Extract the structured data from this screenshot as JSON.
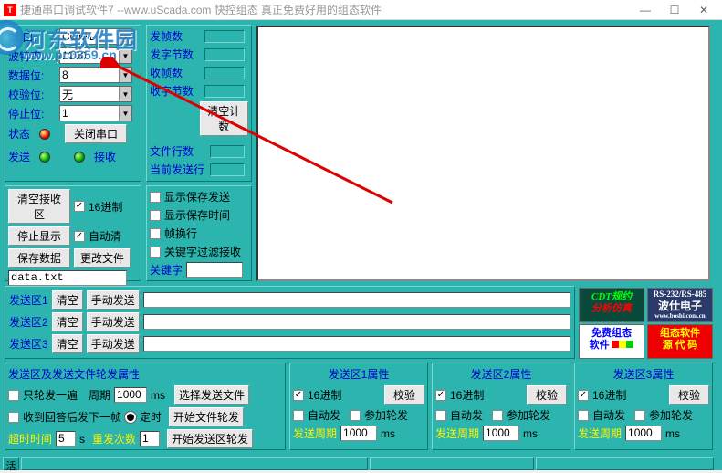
{
  "window": {
    "title": "捷通串口调试软件7    --www.uScada.com    快控组态  真正免费好用的组态软件",
    "min": "—",
    "max": "☐",
    "close": "✕"
  },
  "watermark": {
    "name": "河东软件园",
    "url": "www.pc0359.cn"
  },
  "serial": {
    "port_label": "端    口:",
    "port": "COM1",
    "baud_label": "波特率:",
    "baud": "1200",
    "databits_label": "数据位:",
    "databits": "8",
    "parity_label": "校验位:",
    "parity": "无",
    "stopbits_label": "停止位:",
    "stopbits": "1",
    "status_label": "状态",
    "close_btn": "关闭串口",
    "send_label": "发送",
    "recv_label": "接收"
  },
  "counters": {
    "frames_sent": "发帧数",
    "bytes_sent": "发字节数",
    "frames_recv": "收帧数",
    "bytes_recv": "收字节数",
    "clear_btn": "清空计数",
    "file_lines": "文件行数",
    "current_line": "当前发送行"
  },
  "recv_opts": {
    "clear_btn": "清空接收区",
    "hex_chk": "16进制",
    "stop_btn": "停止显示",
    "autoclear_chk": "自动清",
    "save_btn": "保存数据",
    "changefile_btn": "更改文件",
    "filename": "data.txt"
  },
  "display_opts": {
    "show_save_send": "显示保存发送",
    "show_save_time": "显示保存时间",
    "frame_wrap": "帧换行",
    "keyword_filter": "关键字过滤接收",
    "keyword_label": "关键字"
  },
  "send_areas": {
    "a1_label": "发送区1",
    "a2_label": "发送区2",
    "a3_label": "发送区3",
    "clear": "清空",
    "manual": "手动发送"
  },
  "poll": {
    "title": "发送区及发送文件轮发属性",
    "once": "只轮发一遍",
    "period_lbl": "周期",
    "period": "1000",
    "ms": "ms",
    "select_file": "选择发送文件",
    "wait_reply": "收到回答后发下一帧",
    "on_time": "定时",
    "start_file": "开始文件轮发",
    "timeout_lbl": "超时时间",
    "timeout": "5",
    "s": "s",
    "retry_lbl": "重发次数",
    "retry": "1",
    "start_area": "开始发送区轮发"
  },
  "area_props": {
    "a1_title": "发送区1属性",
    "a2_title": "发送区2属性",
    "a3_title": "发送区3属性",
    "hex": "16进制",
    "verify": "校验",
    "auto": "自动发",
    "join": "参加轮发",
    "period_lbl": "发送周期",
    "period": "1000",
    "ms": "ms"
  },
  "ads": {
    "cdt1": "CDT规约",
    "cdt2": "分析仿真",
    "rs1": "RS-232/RS-485",
    "rs2": "波仕电子",
    "rs3": "www.boshi.com.cn",
    "free1": "免费组态",
    "free2": "软件",
    "src1": "组态软件",
    "src2": "源 代 码"
  },
  "status": {
    "cell": "活"
  }
}
